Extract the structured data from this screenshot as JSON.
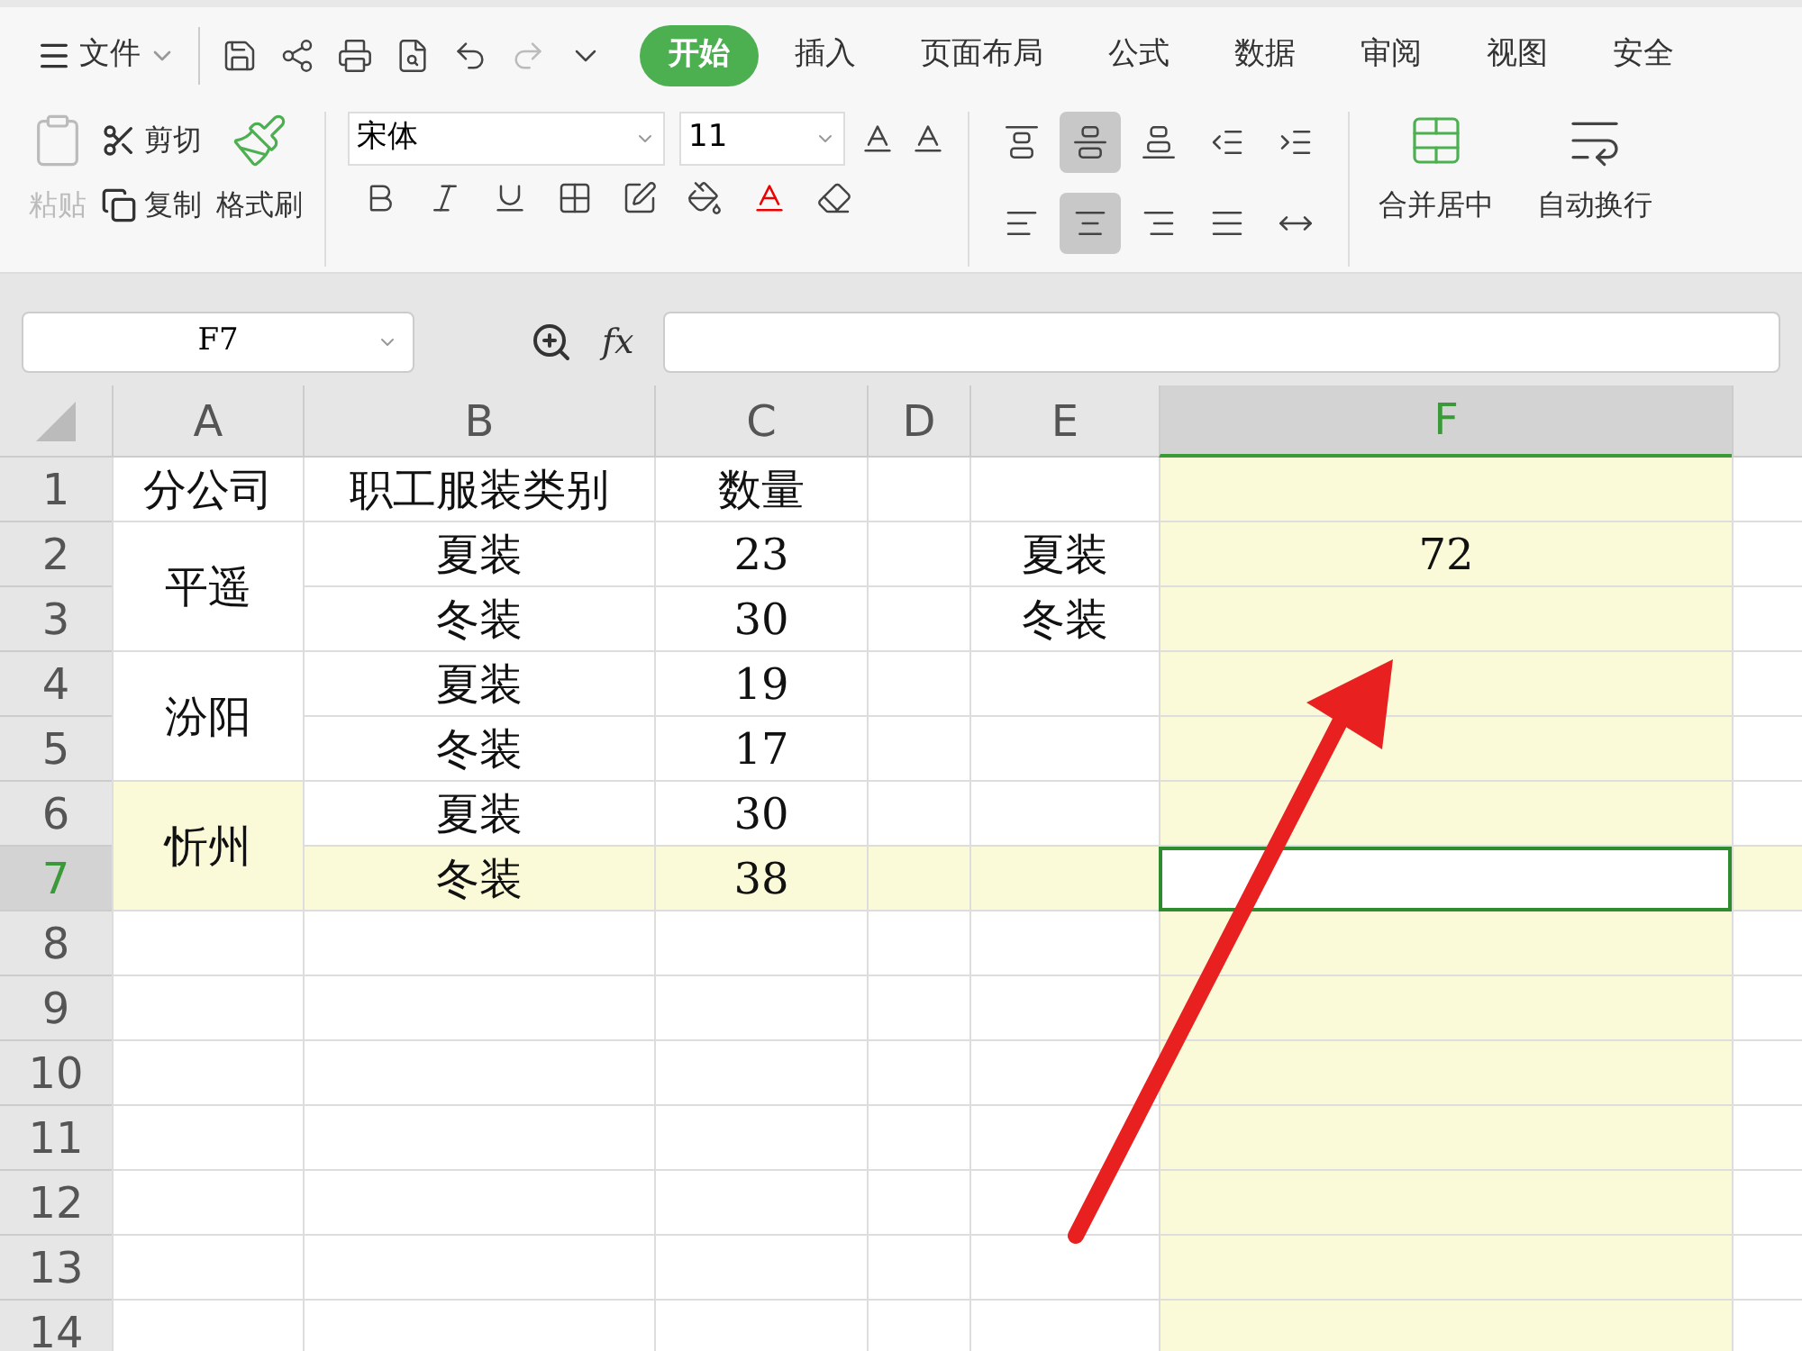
{
  "menu": {
    "file": "文件",
    "tabs": [
      {
        "label": "开始",
        "selected": true
      },
      {
        "label": "插入",
        "selected": false
      },
      {
        "label": "页面布局",
        "selected": false
      },
      {
        "label": "公式",
        "selected": false
      },
      {
        "label": "数据",
        "selected": false
      },
      {
        "label": "审阅",
        "selected": false
      },
      {
        "label": "视图",
        "selected": false
      },
      {
        "label": "安全",
        "selected": false
      }
    ]
  },
  "ribbon": {
    "paste": {
      "label": "粘贴",
      "disabled": true
    },
    "cut": "剪切",
    "copy": "复制",
    "format_painter": "格式刷",
    "font_name": "宋体",
    "font_size": "11",
    "align_buttons": [
      {
        "selected": false
      },
      {
        "selected": true
      },
      {
        "selected": false
      },
      {
        "selected": false
      },
      {
        "selected": false
      },
      {
        "selected": false
      },
      {
        "selected": true
      },
      {
        "selected": false
      },
      {
        "selected": false
      },
      {
        "selected": false
      }
    ],
    "merge": "合并居中",
    "wrap": "自动换行"
  },
  "formula_bar": {
    "name_box": "F7",
    "fx": "fx"
  },
  "columns": [
    {
      "letter": "A",
      "selected": false
    },
    {
      "letter": "B",
      "selected": false
    },
    {
      "letter": "C",
      "selected": false
    },
    {
      "letter": "D",
      "selected": false
    },
    {
      "letter": "E",
      "selected": false
    },
    {
      "letter": "F",
      "selected": true
    }
  ],
  "rows": [
    {
      "number": "1",
      "selected": false,
      "cells": {
        "A": "分公司",
        "B": "职工服装类别",
        "C": "数量"
      }
    },
    {
      "number": "2",
      "selected": false,
      "cells": {
        "A": "平遥",
        "B": "夏装",
        "C": "23",
        "E": "夏装",
        "F": "72"
      },
      "merged_a": true
    },
    {
      "number": "3",
      "selected": false,
      "cells": {
        "B": "冬装",
        "C": "30",
        "E": "冬装"
      }
    },
    {
      "number": "4",
      "selected": false,
      "cells": {
        "A": "汾阳",
        "B": "夏装",
        "C": "19"
      },
      "merged_a": true
    },
    {
      "number": "5",
      "selected": false,
      "cells": {
        "B": "冬装",
        "C": "17"
      }
    },
    {
      "number": "6",
      "selected": false,
      "cells": {
        "A": "忻州",
        "B": "夏装",
        "C": "30"
      },
      "merged_a": true
    },
    {
      "number": "7",
      "selected": true,
      "cells": {
        "B": "冬装",
        "C": "38"
      }
    },
    {
      "number": "8",
      "selected": false,
      "cells": {}
    },
    {
      "number": "9",
      "selected": false,
      "cells": {}
    },
    {
      "number": "10",
      "selected": false,
      "cells": {}
    },
    {
      "number": "11",
      "selected": false,
      "cells": {}
    },
    {
      "number": "12",
      "selected": false,
      "cells": {}
    },
    {
      "number": "13",
      "selected": false,
      "cells": {}
    },
    {
      "number": "14",
      "selected": false,
      "cells": {}
    }
  ]
}
